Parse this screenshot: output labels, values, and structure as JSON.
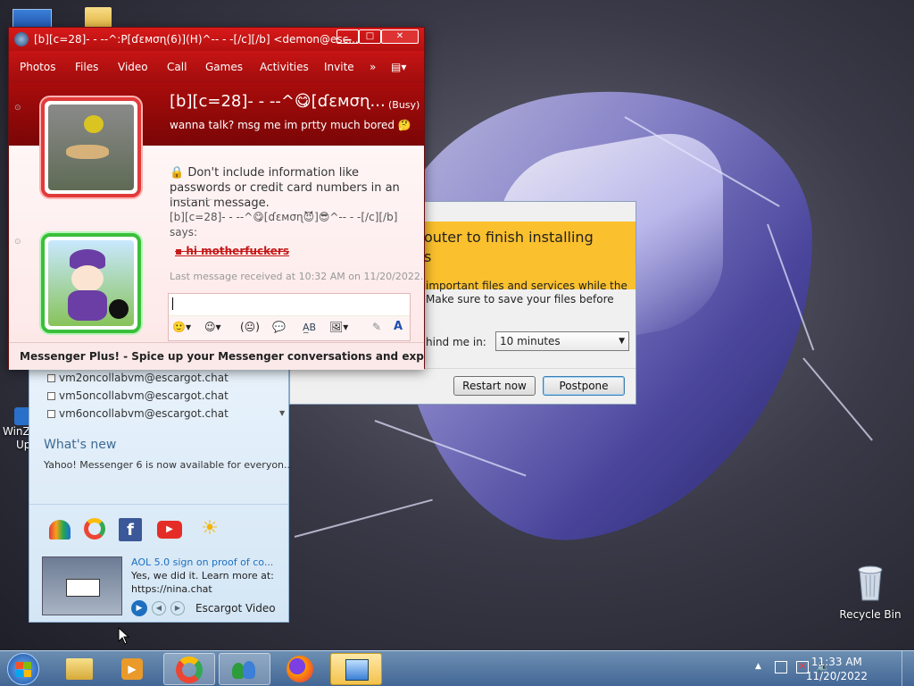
{
  "desktop": {
    "recycle_bin_label": "Recycle Bin",
    "winz_label_1": "WinZ",
    "winz_label_2": "Up"
  },
  "chat_window": {
    "title": "[b][c=28]- - --^:P[ɗɛмσɳ(6)](H)^-- - -[/c][/b] <demon@esc...",
    "menu": [
      "Photos",
      "Files",
      "Video",
      "Call",
      "Games",
      "Activities",
      "Invite"
    ],
    "contact_name": "[b][c=28]- - --^😋[ɗɛмσɳ...",
    "contact_status": "(Busy)",
    "personal_message": "wanna talk? msg me im prtty much bored 🤔",
    "warning": "Don't include information like passwords or credit card numbers in an instant message.",
    "sender_line": "[b][c=28]- - --^😋[ɗɛмσɳ😈]😎^-- - -[/c][/b]",
    "says": "says:",
    "message": "hi motherfuckers",
    "last_message": "Last message received at 10:32 AM on 11/20/2022.",
    "footer": "Messenger Plus! - Spice up your Messenger conversations and experience wit..."
  },
  "main_window": {
    "contacts": [
      "vm2oncollabvm@escargot.chat",
      "vm5oncollabvm@escargot.chat",
      "vm6oncollabvm@escargot.chat"
    ],
    "whats_new_heading": "What's new",
    "whats_new_text": "Yahoo! Messenger 6 is now available for everyon...",
    "video_title": "AOL 5.0 sign on proof of co...",
    "video_desc_1": "Yes, we did it. Learn more at:",
    "video_desc_2": "https://nina.chat",
    "video_source": "Escargot Video"
  },
  "restart_dialog": {
    "banner_line_1": "outer to finish installing",
    "banner_line_2": "s",
    "body_line_1": "important files and services while the",
    "body_line_2": "Make sure to save your files before",
    "remind_label": "hind me in:",
    "remind_value": "10 minutes",
    "restart_button": "Restart now",
    "postpone_button": "Postpone"
  },
  "taskbar": {
    "time": "11:33 AM",
    "date": "11/20/2022"
  },
  "colors": {
    "chat_red": "#c71414",
    "banner_yellow": "#fbc02d"
  }
}
